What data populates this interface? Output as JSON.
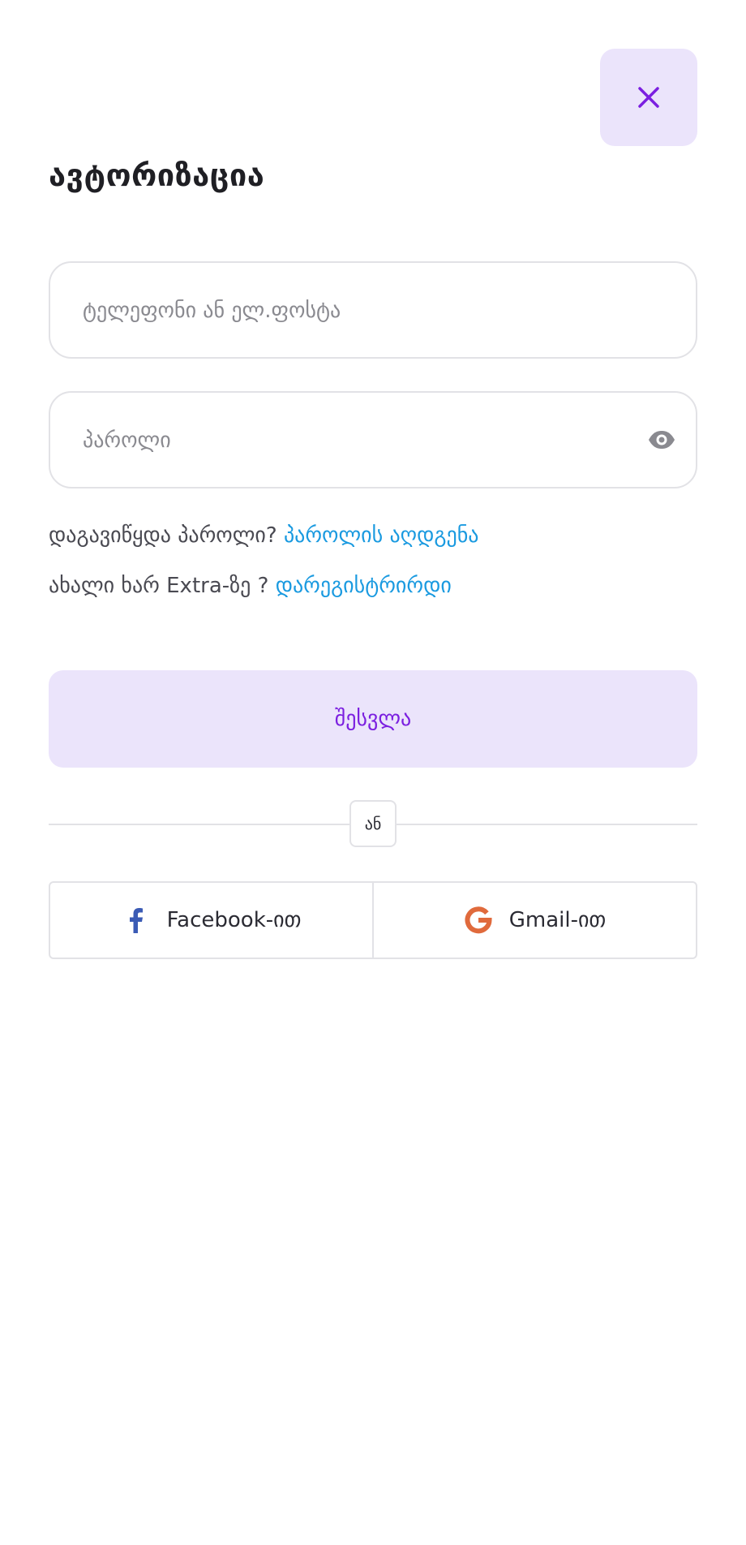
{
  "header": {
    "close_icon": "close-icon",
    "title": "ავტორიზაცია"
  },
  "form": {
    "phone_placeholder": "ტელეფონი ან ელ.ფოსტა",
    "phone_value": "",
    "password_placeholder": "პაროლი",
    "password_value": "",
    "eye_icon": "eye-icon"
  },
  "links": {
    "forgot_prefix": "დაგავიწყდა პაროლი?",
    "forgot_link": "პაროლის აღდგენა",
    "register_prefix": "ახალი ხარ Extra-ზე ?",
    "register_link": "დარეგისტრირდი"
  },
  "submit_label": "შესვლა",
  "divider_label": "ან",
  "social": {
    "facebook_label": "Facebook-ით",
    "facebook_icon": "facebook-icon",
    "gmail_label": "Gmail-ით",
    "gmail_icon": "google-icon"
  },
  "colors": {
    "accent": "#7b1fe0",
    "accent_bg": "#ebe4fb",
    "link": "#1a9ae0",
    "facebook": "#3b5bb5",
    "google": "#e06a3c"
  }
}
